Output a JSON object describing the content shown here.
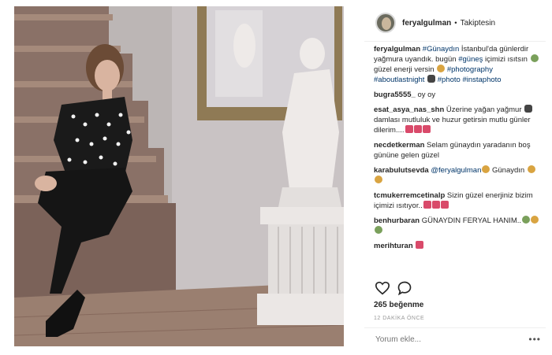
{
  "header": {
    "username": "feryalgulman",
    "separator": "•",
    "follow_status": "Takiptesin"
  },
  "caption": {
    "username": "feryalgulman",
    "text_parts": [
      {
        "type": "tag",
        "text": "#Günaydın"
      },
      {
        "type": "text",
        "text": " İstanbul'da günlerdir yağmura uyandık. bugün "
      },
      {
        "type": "tag",
        "text": "#güneş"
      },
      {
        "type": "text",
        "text": " içimizi ısıtsın "
      },
      {
        "type": "emoji",
        "class": "green"
      },
      {
        "type": "text",
        "text": " güzel enerji versin "
      },
      {
        "type": "emoji",
        "class": ""
      },
      {
        "type": "text",
        "text": " "
      },
      {
        "type": "tag",
        "text": "#photography"
      },
      {
        "type": "text",
        "text": " "
      },
      {
        "type": "tag",
        "text": "#aboutlastnight"
      },
      {
        "type": "text",
        "text": " "
      },
      {
        "type": "emoji",
        "class": "dark"
      },
      {
        "type": "text",
        "text": " "
      },
      {
        "type": "tag",
        "text": "#photo"
      },
      {
        "type": "text",
        "text": " "
      },
      {
        "type": "tag",
        "text": "#instaphoto"
      }
    ]
  },
  "comments": [
    {
      "username": "bugra5555_",
      "text": " oy oy",
      "emojis": []
    },
    {
      "username": "esat_asya_nas_shn",
      "text": " Üzerine yağan yağmur ",
      "text2": " damlası mutluluk ve huzur getirsin mutlu günler dilerim....",
      "emojis_mid": [
        "dark"
      ],
      "emojis": [
        "red",
        "red",
        "red"
      ]
    },
    {
      "username": "necdetkerman",
      "text": " Selam günaydın yaradanın boş gününe gelen güzel",
      "emojis": []
    },
    {
      "username": "karabulutsevda",
      "mention": " @feryalgulman",
      "text": " Günaydın ",
      "emojis_after_mention": [
        ""
      ],
      "emojis": [
        "",
        ""
      ]
    },
    {
      "username": "tcmukerremcetinalp",
      "text": " Sizin güzel enerjiniz bizim içimizi ısıtıyor..",
      "emojis": [
        "red",
        "red",
        "red"
      ]
    },
    {
      "username": "benhurbaran",
      "text": " GÜNAYDIN FERYAL HANIM..",
      "emojis": [
        "green",
        "",
        "green"
      ]
    },
    {
      "username": "merihturan",
      "text": " ",
      "emojis": [
        "red"
      ]
    }
  ],
  "likes": "265 beğenme",
  "time": "12 DAKİKA ÖNCE",
  "add_comment": {
    "placeholder": "Yorum ekle..."
  },
  "more": "•••",
  "icons": {
    "like": "heart-icon",
    "comment": "comment-bubble-icon"
  }
}
